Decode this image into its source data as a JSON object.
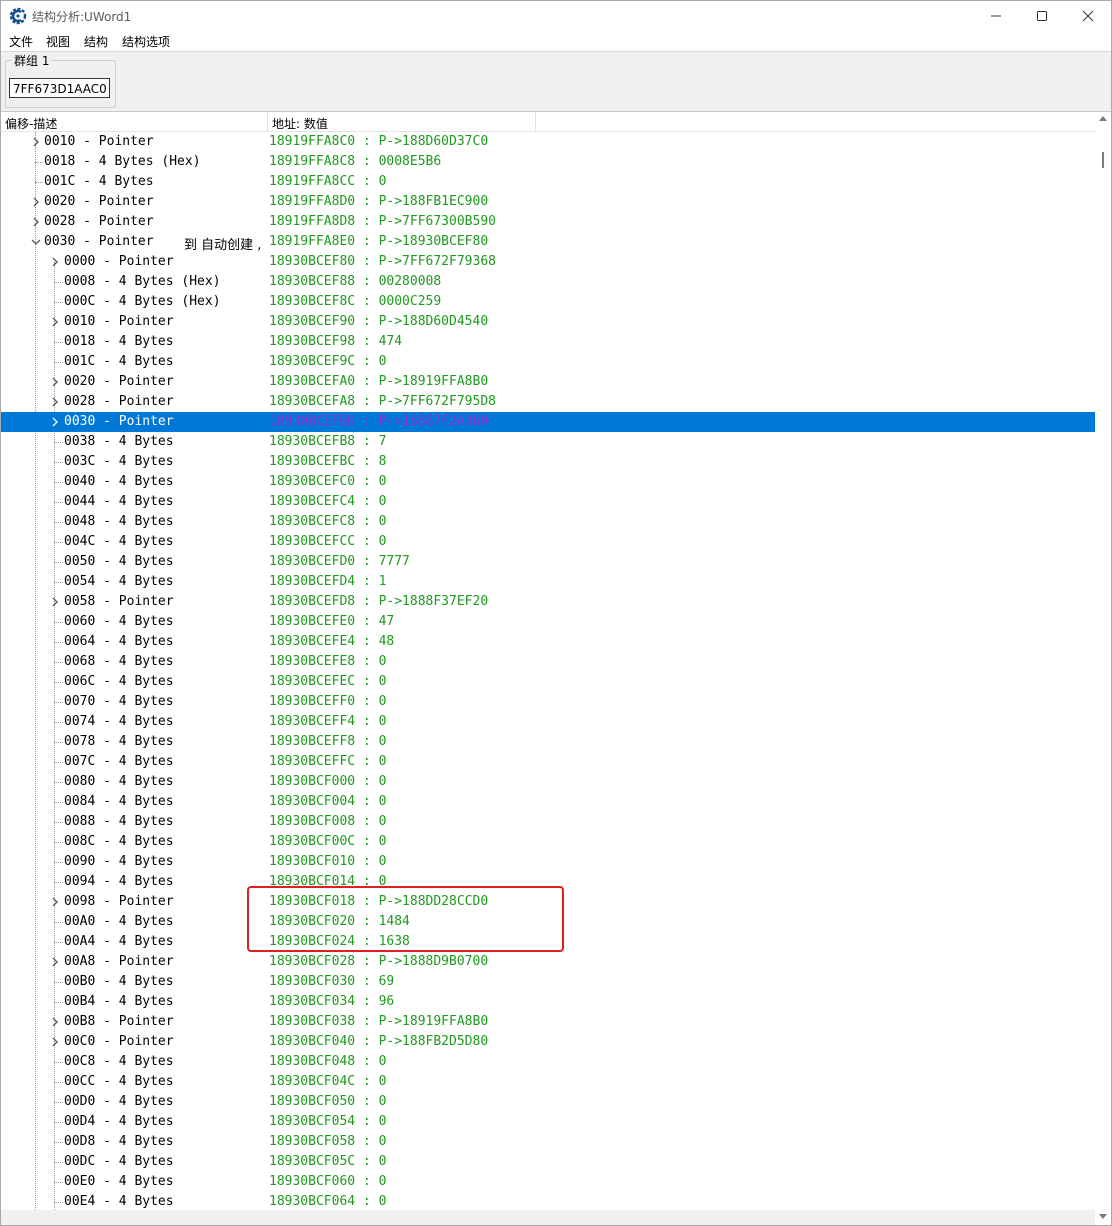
{
  "window": {
    "title": "结构分析:UWord1",
    "minimize_icon": "minimize-icon",
    "maximize_icon": "maximize-icon",
    "close_icon": "close-icon"
  },
  "menu": [
    "文件",
    "视图",
    "结构",
    "结构选项"
  ],
  "group": {
    "label": "群组 1",
    "address": "7FF673D1AAC0"
  },
  "columns": {
    "offset_desc": "偏移-描述",
    "address_value": "地址: 数值"
  },
  "colors": {
    "value_text": "#1e9a1e",
    "selection": "#0078d7",
    "selected_value": "#9a2fd6",
    "highlight_box": "#e02020"
  },
  "rows": [
    {
      "level": 1,
      "exp": "collapsed",
      "desc": "0010 - Pointer",
      "val": "18919FFA8C0 : P->188D60D37C0"
    },
    {
      "level": 1,
      "exp": "none",
      "desc": "0018 - 4 Bytes (Hex)",
      "val": "18919FFA8C8 : 0008E5B6"
    },
    {
      "level": 1,
      "exp": "none",
      "desc": "001C - 4 Bytes",
      "val": "18919FFA8CC : 0"
    },
    {
      "level": 1,
      "exp": "collapsed",
      "desc": "0020 - Pointer",
      "val": "18919FFA8D0 : P->188FB1EC900"
    },
    {
      "level": 1,
      "exp": "collapsed",
      "desc": "0028 - Pointer",
      "val": "18919FFA8D8 : P->7FF67300B590"
    },
    {
      "level": 1,
      "exp": "expanded",
      "desc": "0030 - Pointer ",
      "desc_extra": "到 自动创建 ,",
      "val": "18919FFA8E0 : P->18930BCEF80"
    },
    {
      "level": 2,
      "exp": "collapsed",
      "desc": "0000 - Pointer",
      "val": "18930BCEF80 : P->7FF672F79368"
    },
    {
      "level": 2,
      "exp": "none",
      "desc": "0008 - 4 Bytes (Hex)",
      "val": "18930BCEF88 : 00280008"
    },
    {
      "level": 2,
      "exp": "none",
      "desc": "000C - 4 Bytes (Hex)",
      "val": "18930BCEF8C : 0000C259"
    },
    {
      "level": 2,
      "exp": "collapsed",
      "desc": "0010 - Pointer",
      "val": "18930BCEF90 : P->188D60D4540"
    },
    {
      "level": 2,
      "exp": "none",
      "desc": "0018 - 4 Bytes",
      "val": "18930BCEF98 : 474"
    },
    {
      "level": 2,
      "exp": "none",
      "desc": "001C - 4 Bytes",
      "val": "18930BCEF9C : 0"
    },
    {
      "level": 2,
      "exp": "collapsed",
      "desc": "0020 - Pointer",
      "val": "18930BCEFA0 : P->18919FFA8B0"
    },
    {
      "level": 2,
      "exp": "collapsed",
      "desc": "0028 - Pointer",
      "val": "18930BCEFA8 : P->7FF672F795D8"
    },
    {
      "level": 2,
      "exp": "collapsed",
      "desc": "0030 - Pointer",
      "val": "18930BCEFB0 : P->18887F2A360",
      "selected": true
    },
    {
      "level": 2,
      "exp": "none",
      "desc": "0038 - 4 Bytes",
      "val": "18930BCEFB8 : 7"
    },
    {
      "level": 2,
      "exp": "none",
      "desc": "003C - 4 Bytes",
      "val": "18930BCEFBC : 8"
    },
    {
      "level": 2,
      "exp": "none",
      "desc": "0040 - 4 Bytes",
      "val": "18930BCEFC0 : 0"
    },
    {
      "level": 2,
      "exp": "none",
      "desc": "0044 - 4 Bytes",
      "val": "18930BCEFC4 : 0"
    },
    {
      "level": 2,
      "exp": "none",
      "desc": "0048 - 4 Bytes",
      "val": "18930BCEFC8 : 0"
    },
    {
      "level": 2,
      "exp": "none",
      "desc": "004C - 4 Bytes",
      "val": "18930BCEFCC : 0"
    },
    {
      "level": 2,
      "exp": "none",
      "desc": "0050 - 4 Bytes",
      "val": "18930BCEFD0 : 7777"
    },
    {
      "level": 2,
      "exp": "none",
      "desc": "0054 - 4 Bytes",
      "val": "18930BCEFD4 : 1"
    },
    {
      "level": 2,
      "exp": "collapsed",
      "desc": "0058 - Pointer",
      "val": "18930BCEFD8 : P->1888F37EF20"
    },
    {
      "level": 2,
      "exp": "none",
      "desc": "0060 - 4 Bytes",
      "val": "18930BCEFE0 : 47"
    },
    {
      "level": 2,
      "exp": "none",
      "desc": "0064 - 4 Bytes",
      "val": "18930BCEFE4 : 48"
    },
    {
      "level": 2,
      "exp": "none",
      "desc": "0068 - 4 Bytes",
      "val": "18930BCEFE8 : 0"
    },
    {
      "level": 2,
      "exp": "none",
      "desc": "006C - 4 Bytes",
      "val": "18930BCEFEC : 0"
    },
    {
      "level": 2,
      "exp": "none",
      "desc": "0070 - 4 Bytes",
      "val": "18930BCEFF0 : 0"
    },
    {
      "level": 2,
      "exp": "none",
      "desc": "0074 - 4 Bytes",
      "val": "18930BCEFF4 : 0"
    },
    {
      "level": 2,
      "exp": "none",
      "desc": "0078 - 4 Bytes",
      "val": "18930BCEFF8 : 0"
    },
    {
      "level": 2,
      "exp": "none",
      "desc": "007C - 4 Bytes",
      "val": "18930BCEFFC : 0"
    },
    {
      "level": 2,
      "exp": "none",
      "desc": "0080 - 4 Bytes",
      "val": "18930BCF000 : 0"
    },
    {
      "level": 2,
      "exp": "none",
      "desc": "0084 - 4 Bytes",
      "val": "18930BCF004 : 0"
    },
    {
      "level": 2,
      "exp": "none",
      "desc": "0088 - 4 Bytes",
      "val": "18930BCF008 : 0"
    },
    {
      "level": 2,
      "exp": "none",
      "desc": "008C - 4 Bytes",
      "val": "18930BCF00C : 0"
    },
    {
      "level": 2,
      "exp": "none",
      "desc": "0090 - 4 Bytes",
      "val": "18930BCF010 : 0"
    },
    {
      "level": 2,
      "exp": "none",
      "desc": "0094 - 4 Bytes",
      "val": "18930BCF014 : 0"
    },
    {
      "level": 2,
      "exp": "collapsed",
      "desc": "0098 - Pointer",
      "val": "18930BCF018 : P->188DD28CCD0"
    },
    {
      "level": 2,
      "exp": "none",
      "desc": "00A0 - 4 Bytes",
      "val": "18930BCF020 : 1484"
    },
    {
      "level": 2,
      "exp": "none",
      "desc": "00A4 - 4 Bytes",
      "val": "18930BCF024 : 1638"
    },
    {
      "level": 2,
      "exp": "collapsed",
      "desc": "00A8 - Pointer",
      "val": "18930BCF028 : P->1888D9B0700"
    },
    {
      "level": 2,
      "exp": "none",
      "desc": "00B0 - 4 Bytes",
      "val": "18930BCF030 : 69"
    },
    {
      "level": 2,
      "exp": "none",
      "desc": "00B4 - 4 Bytes",
      "val": "18930BCF034 : 96"
    },
    {
      "level": 2,
      "exp": "collapsed",
      "desc": "00B8 - Pointer",
      "val": "18930BCF038 : P->18919FFA8B0"
    },
    {
      "level": 2,
      "exp": "collapsed",
      "desc": "00C0 - Pointer",
      "val": "18930BCF040 : P->188FB2D5D80"
    },
    {
      "level": 2,
      "exp": "none",
      "desc": "00C8 - 4 Bytes",
      "val": "18930BCF048 : 0"
    },
    {
      "level": 2,
      "exp": "none",
      "desc": "00CC - 4 Bytes",
      "val": "18930BCF04C : 0"
    },
    {
      "level": 2,
      "exp": "none",
      "desc": "00D0 - 4 Bytes",
      "val": "18930BCF050 : 0"
    },
    {
      "level": 2,
      "exp": "none",
      "desc": "00D4 - 4 Bytes",
      "val": "18930BCF054 : 0"
    },
    {
      "level": 2,
      "exp": "none",
      "desc": "00D8 - 4 Bytes",
      "val": "18930BCF058 : 0"
    },
    {
      "level": 2,
      "exp": "none",
      "desc": "00DC - 4 Bytes",
      "val": "18930BCF05C : 0"
    },
    {
      "level": 2,
      "exp": "none",
      "desc": "00E0 - 4 Bytes",
      "val": "18930BCF060 : 0"
    },
    {
      "level": 2,
      "exp": "none",
      "desc": "00E4 - 4 Bytes",
      "val": "18930BCF064 : 0"
    }
  ]
}
